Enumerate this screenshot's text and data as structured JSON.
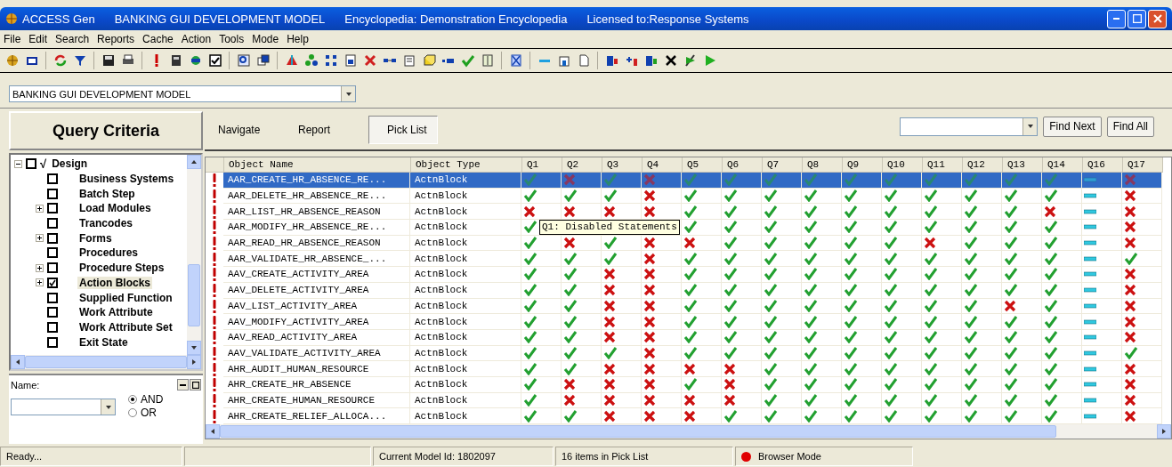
{
  "window": {
    "title_parts": [
      "ACCESS Gen",
      "BANKING GUI DEVELOPMENT MODEL",
      "Encyclopedia: Demonstration Encyclopedia",
      "Licensed to:Response Systems"
    ]
  },
  "menu": [
    "File",
    "Edit",
    "Search",
    "Reports",
    "Cache",
    "Action",
    "Tools",
    "Mode",
    "Help"
  ],
  "model_select": {
    "value": "BANKING GUI DEVELOPMENT MODEL"
  },
  "query_panel": {
    "title": "Query Criteria",
    "tree": [
      {
        "label": "Design",
        "flag": "√",
        "checked": false,
        "expanded": true,
        "selected": false,
        "children": [
          {
            "label": "Business Systems",
            "checked": false,
            "expandable": false,
            "selected": false
          },
          {
            "label": "Batch Step",
            "checked": false,
            "expandable": false,
            "selected": false
          },
          {
            "label": "Load Modules",
            "checked": false,
            "expandable": true,
            "selected": false
          },
          {
            "label": "Trancodes",
            "checked": false,
            "expandable": false,
            "selected": false
          },
          {
            "label": "Forms",
            "checked": false,
            "expandable": true,
            "selected": false
          },
          {
            "label": "Procedures",
            "checked": false,
            "expandable": false,
            "selected": false
          },
          {
            "label": "Procedure Steps",
            "checked": false,
            "expandable": true,
            "selected": false
          },
          {
            "label": "Action Blocks",
            "checked": true,
            "expandable": true,
            "selected": true
          },
          {
            "label": "Supplied Function",
            "checked": false,
            "expandable": false,
            "selected": false
          },
          {
            "label": "Work Attribute",
            "checked": false,
            "expandable": false,
            "selected": false
          },
          {
            "label": "Work Attribute Set",
            "checked": false,
            "expandable": false,
            "selected": false
          },
          {
            "label": "Exit State",
            "checked": false,
            "expandable": false,
            "selected": false
          }
        ]
      }
    ]
  },
  "name_filter": {
    "label": "Name:",
    "options": [
      {
        "label": "AND",
        "selected": true
      },
      {
        "label": "OR",
        "selected": false
      }
    ]
  },
  "tabs": [
    {
      "label": "Navigate",
      "selected": false
    },
    {
      "label": "Report",
      "selected": false
    },
    {
      "label": "Pick List",
      "selected": true
    }
  ],
  "find": {
    "buttons": [
      "Find Next",
      "Find All"
    ]
  },
  "table": {
    "columns": [
      "Object Name",
      "Object Type",
      "Q1",
      "Q2",
      "Q3",
      "Q4",
      "Q5",
      "Q6",
      "Q7",
      "Q8",
      "Q9",
      "Q10",
      "Q11",
      "Q12",
      "Q13",
      "Q14",
      "Q16",
      "Q17"
    ],
    "rows": [
      {
        "name": "AAR_CREATE_HR_ABSENCE_RE...",
        "type": "ActnBlock",
        "selected": true,
        "cells": [
          {
            "kind": "check"
          },
          {
            "kind": "cross"
          },
          {
            "kind": "check"
          },
          {
            "kind": "cross"
          },
          {
            "kind": "check"
          },
          {
            "kind": "check"
          },
          {
            "kind": "check"
          },
          {
            "kind": "check"
          },
          {
            "kind": "check"
          },
          {
            "kind": "check"
          },
          {
            "kind": "check"
          },
          {
            "kind": "check"
          },
          {
            "kind": "check"
          },
          {
            "kind": "check"
          },
          {
            "kind": "dash"
          },
          {
            "kind": "cross"
          }
        ]
      },
      {
        "name": "AAR_DELETE_HR_ABSENCE_RE...",
        "type": "ActnBlock",
        "selected": false,
        "cells": [
          {
            "kind": "check"
          },
          {
            "kind": "check"
          },
          {
            "kind": "check"
          },
          {
            "kind": "cross"
          },
          {
            "kind": "check"
          },
          {
            "kind": "check"
          },
          {
            "kind": "check"
          },
          {
            "kind": "check"
          },
          {
            "kind": "check"
          },
          {
            "kind": "check"
          },
          {
            "kind": "check"
          },
          {
            "kind": "check"
          },
          {
            "kind": "check"
          },
          {
            "kind": "check"
          },
          {
            "kind": "dash"
          },
          {
            "kind": "cross"
          }
        ]
      },
      {
        "name": "AAR_LIST_HR_ABSENCE_REASON",
        "type": "ActnBlock",
        "selected": false,
        "cells": [
          {
            "kind": "cross"
          },
          {
            "kind": "cross"
          },
          {
            "kind": "cross"
          },
          {
            "kind": "cross"
          },
          {
            "kind": "check"
          },
          {
            "kind": "check"
          },
          {
            "kind": "check"
          },
          {
            "kind": "check"
          },
          {
            "kind": "check"
          },
          {
            "kind": "check"
          },
          {
            "kind": "check"
          },
          {
            "kind": "check"
          },
          {
            "kind": "check"
          },
          {
            "kind": "cross"
          },
          {
            "kind": "dash"
          },
          {
            "kind": "cross"
          }
        ]
      },
      {
        "name": "AAR_MODIFY_HR_ABSENCE_RE...",
        "type": "ActnBlock",
        "selected": false,
        "cells": [
          {
            "kind": "check"
          },
          null,
          null,
          null,
          {
            "kind": "check"
          },
          {
            "kind": "check"
          },
          {
            "kind": "check"
          },
          {
            "kind": "check"
          },
          {
            "kind": "check"
          },
          {
            "kind": "check"
          },
          {
            "kind": "check"
          },
          {
            "kind": "check"
          },
          {
            "kind": "check"
          },
          {
            "kind": "check"
          },
          {
            "kind": "dash"
          },
          {
            "kind": "cross"
          }
        ]
      },
      {
        "name": "AAR_READ_HR_ABSENCE_REASON",
        "type": "ActnBlock",
        "selected": false,
        "cells": [
          {
            "kind": "check"
          },
          {
            "kind": "cross"
          },
          {
            "kind": "check"
          },
          {
            "kind": "cross"
          },
          {
            "kind": "cross"
          },
          {
            "kind": "check"
          },
          {
            "kind": "check"
          },
          {
            "kind": "check"
          },
          {
            "kind": "check"
          },
          {
            "kind": "check"
          },
          {
            "kind": "cross"
          },
          {
            "kind": "check"
          },
          {
            "kind": "check"
          },
          {
            "kind": "check"
          },
          {
            "kind": "dash"
          },
          {
            "kind": "cross"
          }
        ]
      },
      {
        "name": "AAR_VALIDATE_HR_ABSENCE_...",
        "type": "ActnBlock",
        "selected": false,
        "cells": [
          {
            "kind": "check"
          },
          {
            "kind": "check"
          },
          {
            "kind": "check"
          },
          {
            "kind": "cross"
          },
          {
            "kind": "check"
          },
          {
            "kind": "check"
          },
          {
            "kind": "check"
          },
          {
            "kind": "check"
          },
          {
            "kind": "check"
          },
          {
            "kind": "check"
          },
          {
            "kind": "check"
          },
          {
            "kind": "check"
          },
          {
            "kind": "check"
          },
          {
            "kind": "check"
          },
          {
            "kind": "dash"
          },
          {
            "kind": "check"
          }
        ]
      },
      {
        "name": "AAV_CREATE_ACTIVITY_AREA",
        "type": "ActnBlock",
        "selected": false,
        "cells": [
          {
            "kind": "check"
          },
          {
            "kind": "check"
          },
          {
            "kind": "cross"
          },
          {
            "kind": "cross"
          },
          {
            "kind": "check"
          },
          {
            "kind": "check"
          },
          {
            "kind": "check"
          },
          {
            "kind": "check"
          },
          {
            "kind": "check"
          },
          {
            "kind": "check"
          },
          {
            "kind": "check"
          },
          {
            "kind": "check"
          },
          {
            "kind": "check"
          },
          {
            "kind": "check"
          },
          {
            "kind": "dash"
          },
          {
            "kind": "cross"
          }
        ]
      },
      {
        "name": "AAV_DELETE_ACTIVITY_AREA",
        "type": "ActnBlock",
        "selected": false,
        "cells": [
          {
            "kind": "check"
          },
          {
            "kind": "check"
          },
          {
            "kind": "cross"
          },
          {
            "kind": "cross"
          },
          {
            "kind": "check"
          },
          {
            "kind": "check"
          },
          {
            "kind": "check"
          },
          {
            "kind": "check"
          },
          {
            "kind": "check"
          },
          {
            "kind": "check"
          },
          {
            "kind": "check"
          },
          {
            "kind": "check"
          },
          {
            "kind": "check"
          },
          {
            "kind": "check"
          },
          {
            "kind": "dash"
          },
          {
            "kind": "cross"
          }
        ]
      },
      {
        "name": "AAV_LIST_ACTIVITY_AREA",
        "type": "ActnBlock",
        "selected": false,
        "cells": [
          {
            "kind": "check"
          },
          {
            "kind": "check"
          },
          {
            "kind": "cross"
          },
          {
            "kind": "cross"
          },
          {
            "kind": "check"
          },
          {
            "kind": "check"
          },
          {
            "kind": "check"
          },
          {
            "kind": "check"
          },
          {
            "kind": "check"
          },
          {
            "kind": "check"
          },
          {
            "kind": "check"
          },
          {
            "kind": "check"
          },
          {
            "kind": "cross"
          },
          {
            "kind": "check"
          },
          {
            "kind": "dash"
          },
          {
            "kind": "cross"
          }
        ]
      },
      {
        "name": "AAV_MODIFY_ACTIVITY_AREA",
        "type": "ActnBlock",
        "selected": false,
        "cells": [
          {
            "kind": "check"
          },
          {
            "kind": "check"
          },
          {
            "kind": "cross"
          },
          {
            "kind": "cross"
          },
          {
            "kind": "check"
          },
          {
            "kind": "check"
          },
          {
            "kind": "check"
          },
          {
            "kind": "check"
          },
          {
            "kind": "check"
          },
          {
            "kind": "check"
          },
          {
            "kind": "check"
          },
          {
            "kind": "check"
          },
          {
            "kind": "check"
          },
          {
            "kind": "check"
          },
          {
            "kind": "dash"
          },
          {
            "kind": "cross"
          }
        ]
      },
      {
        "name": "AAV_READ_ACTIVITY_AREA",
        "type": "ActnBlock",
        "selected": false,
        "cells": [
          {
            "kind": "check"
          },
          {
            "kind": "check"
          },
          {
            "kind": "cross"
          },
          {
            "kind": "cross"
          },
          {
            "kind": "check"
          },
          {
            "kind": "check"
          },
          {
            "kind": "check"
          },
          {
            "kind": "check"
          },
          {
            "kind": "check"
          },
          {
            "kind": "check"
          },
          {
            "kind": "check"
          },
          {
            "kind": "check"
          },
          {
            "kind": "check"
          },
          {
            "kind": "check"
          },
          {
            "kind": "dash"
          },
          {
            "kind": "cross"
          }
        ]
      },
      {
        "name": "AAV_VALIDATE_ACTIVITY_AREA",
        "type": "ActnBlock",
        "selected": false,
        "cells": [
          {
            "kind": "check"
          },
          {
            "kind": "check"
          },
          {
            "kind": "check"
          },
          {
            "kind": "cross"
          },
          {
            "kind": "check"
          },
          {
            "kind": "check"
          },
          {
            "kind": "check"
          },
          {
            "kind": "check"
          },
          {
            "kind": "check"
          },
          {
            "kind": "check"
          },
          {
            "kind": "check"
          },
          {
            "kind": "check"
          },
          {
            "kind": "check"
          },
          {
            "kind": "check"
          },
          {
            "kind": "dash"
          },
          {
            "kind": "check"
          }
        ]
      },
      {
        "name": "AHR_AUDIT_HUMAN_RESOURCE",
        "type": "ActnBlock",
        "selected": false,
        "cells": [
          {
            "kind": "check"
          },
          {
            "kind": "check"
          },
          {
            "kind": "cross"
          },
          {
            "kind": "cross"
          },
          {
            "kind": "cross"
          },
          {
            "kind": "cross"
          },
          {
            "kind": "check"
          },
          {
            "kind": "check"
          },
          {
            "kind": "check"
          },
          {
            "kind": "check"
          },
          {
            "kind": "check"
          },
          {
            "kind": "check"
          },
          {
            "kind": "check"
          },
          {
            "kind": "check"
          },
          {
            "kind": "dash"
          },
          {
            "kind": "cross"
          }
        ]
      },
      {
        "name": "AHR_CREATE_HR_ABSENCE",
        "type": "ActnBlock",
        "selected": false,
        "cells": [
          {
            "kind": "check"
          },
          {
            "kind": "cross"
          },
          {
            "kind": "cross"
          },
          {
            "kind": "cross"
          },
          {
            "kind": "check"
          },
          {
            "kind": "cross"
          },
          {
            "kind": "check"
          },
          {
            "kind": "check"
          },
          {
            "kind": "check"
          },
          {
            "kind": "check"
          },
          {
            "kind": "check"
          },
          {
            "kind": "check"
          },
          {
            "kind": "check"
          },
          {
            "kind": "check"
          },
          {
            "kind": "dash"
          },
          {
            "kind": "cross"
          }
        ]
      },
      {
        "name": "AHR_CREATE_HUMAN_RESOURCE",
        "type": "ActnBlock",
        "selected": false,
        "cells": [
          {
            "kind": "check"
          },
          {
            "kind": "cross"
          },
          {
            "kind": "cross"
          },
          {
            "kind": "cross"
          },
          {
            "kind": "cross"
          },
          {
            "kind": "cross"
          },
          {
            "kind": "check"
          },
          {
            "kind": "check"
          },
          {
            "kind": "check"
          },
          {
            "kind": "check"
          },
          {
            "kind": "check"
          },
          {
            "kind": "check"
          },
          {
            "kind": "check"
          },
          {
            "kind": "check"
          },
          {
            "kind": "dash"
          },
          {
            "kind": "cross"
          }
        ]
      },
      {
        "name": "AHR_CREATE_RELIEF_ALLOCA...",
        "type": "ActnBlock",
        "selected": false,
        "cells": [
          {
            "kind": "check"
          },
          {
            "kind": "check"
          },
          {
            "kind": "cross"
          },
          {
            "kind": "cross"
          },
          {
            "kind": "cross"
          },
          {
            "kind": "check"
          },
          {
            "kind": "check"
          },
          {
            "kind": "check"
          },
          {
            "kind": "check"
          },
          {
            "kind": "check"
          },
          {
            "kind": "check"
          },
          {
            "kind": "check"
          },
          {
            "kind": "check"
          },
          {
            "kind": "check"
          },
          {
            "kind": "dash"
          },
          {
            "kind": "cross"
          }
        ]
      }
    ]
  },
  "tooltip": {
    "text": "Q1: Disabled Statements"
  },
  "status_bar": [
    {
      "kind": "text",
      "text": "Ready..."
    },
    {
      "kind": "empty"
    },
    {
      "kind": "text",
      "text": "Current Model Id: 1802097"
    },
    {
      "kind": "text",
      "text": "16 items in Pick List"
    },
    {
      "kind": "indicator",
      "text": "Browser Mode",
      "color": "#e00000"
    }
  ]
}
